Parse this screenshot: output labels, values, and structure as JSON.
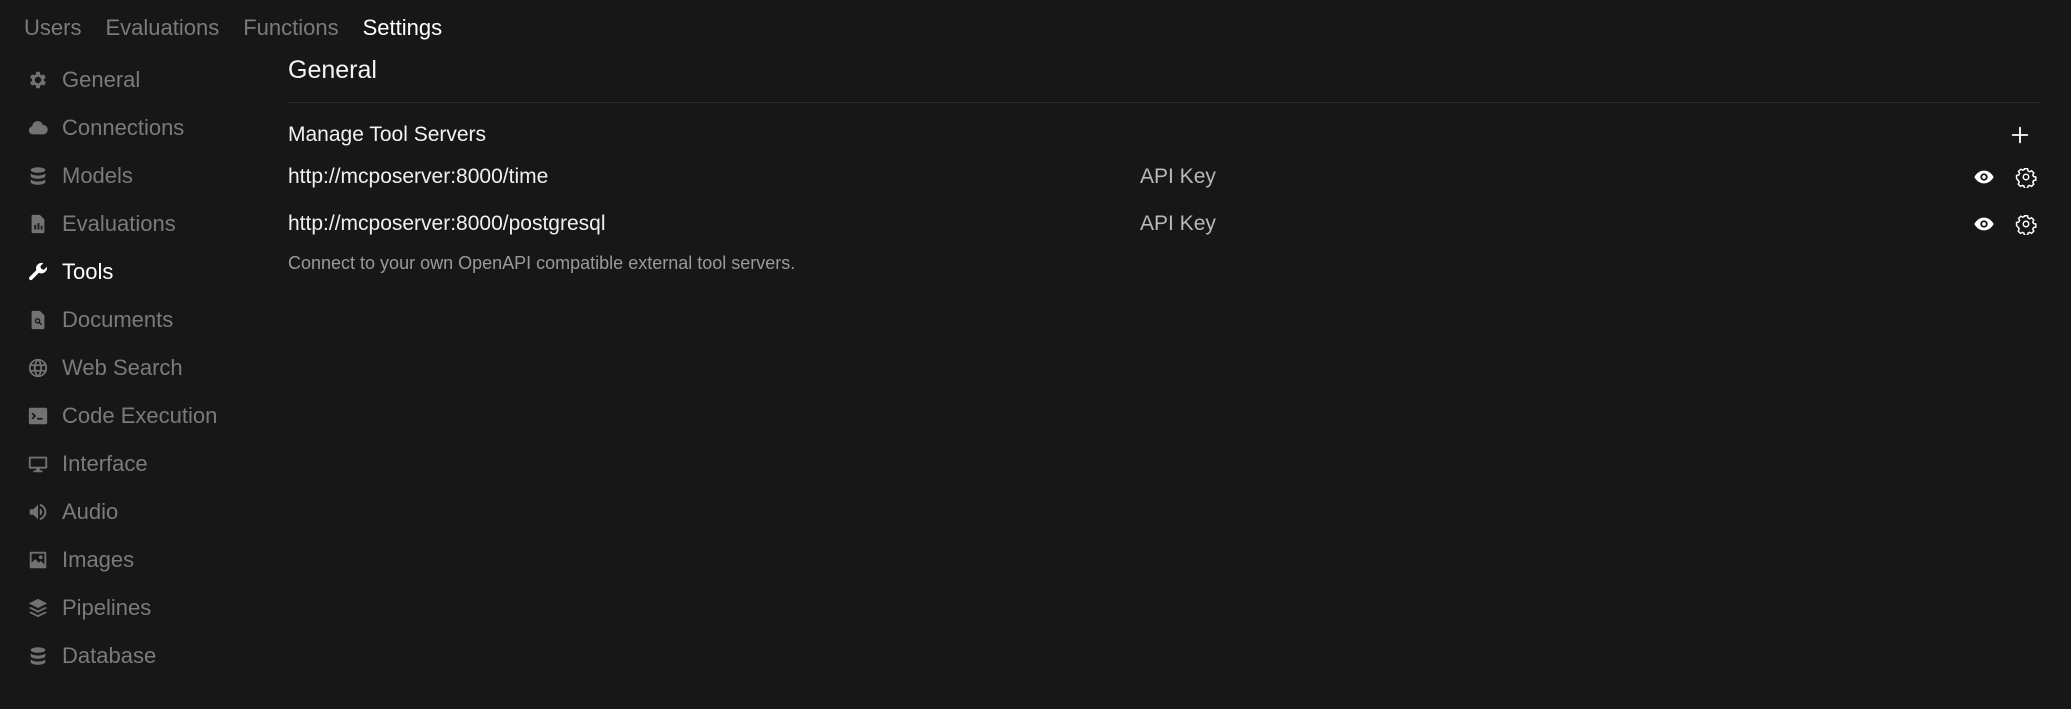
{
  "top_tabs": [
    {
      "label": "Users",
      "active": false
    },
    {
      "label": "Evaluations",
      "active": false
    },
    {
      "label": "Functions",
      "active": false
    },
    {
      "label": "Settings",
      "active": true
    }
  ],
  "sidebar": {
    "items": [
      {
        "label": "General",
        "icon": "gear-icon"
      },
      {
        "label": "Connections",
        "icon": "cloud-icon"
      },
      {
        "label": "Models",
        "icon": "stack-icon"
      },
      {
        "label": "Evaluations",
        "icon": "document-chart-icon"
      },
      {
        "label": "Tools",
        "icon": "wrench-icon",
        "active": true
      },
      {
        "label": "Documents",
        "icon": "document-search-icon"
      },
      {
        "label": "Web Search",
        "icon": "globe-icon"
      },
      {
        "label": "Code Execution",
        "icon": "terminal-icon"
      },
      {
        "label": "Interface",
        "icon": "monitor-icon"
      },
      {
        "label": "Audio",
        "icon": "speaker-icon"
      },
      {
        "label": "Images",
        "icon": "image-icon"
      },
      {
        "label": "Pipelines",
        "icon": "layers-icon"
      },
      {
        "label": "Database",
        "icon": "database-icon"
      }
    ]
  },
  "main": {
    "section_title": "General",
    "manage_title": "Manage Tool Servers",
    "servers": [
      {
        "url": "http://mcposerver:8000/time",
        "key_label": "API Key"
      },
      {
        "url": "http://mcposerver:8000/postgresql",
        "key_label": "API Key"
      }
    ],
    "help_text": "Connect to your own OpenAPI compatible external tool servers."
  },
  "colors": {
    "background": "#171717",
    "text_active": "#ffffff",
    "text_muted": "#7b7b7b"
  }
}
